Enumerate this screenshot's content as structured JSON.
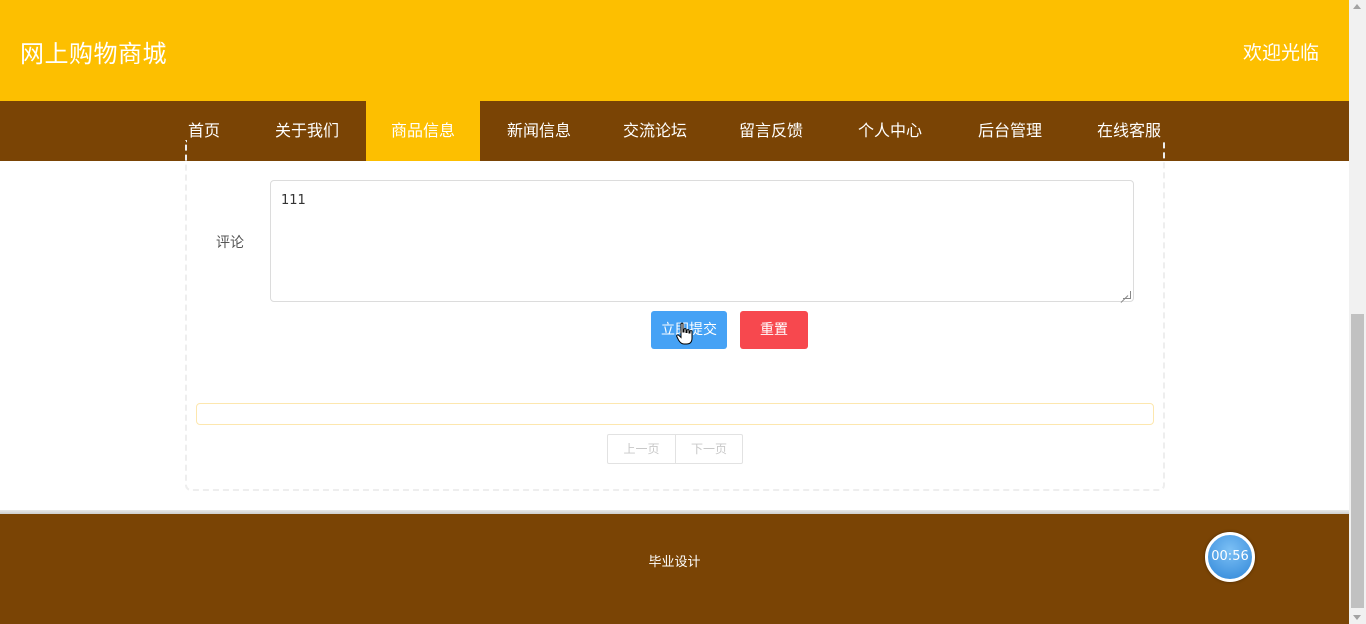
{
  "header": {
    "site_title": "网上购物商城",
    "welcome": "欢迎光临"
  },
  "nav": {
    "items": [
      {
        "label": "首页"
      },
      {
        "label": "关于我们"
      },
      {
        "label": "商品信息",
        "active": true
      },
      {
        "label": "新闻信息"
      },
      {
        "label": "交流论坛"
      },
      {
        "label": "留言反馈"
      },
      {
        "label": "个人中心"
      },
      {
        "label": "后台管理"
      },
      {
        "label": "在线客服"
      }
    ]
  },
  "comment_form": {
    "label": "评论",
    "value": "111",
    "submit_label": "立即提交",
    "reset_label": "重置"
  },
  "pagination": {
    "prev_label": "上一页",
    "next_label": "下一页"
  },
  "footer": {
    "text": "毕业设计"
  },
  "timer": {
    "value": "00:56"
  },
  "colors": {
    "header_bg": "#fdbf00",
    "nav_bg": "#7a4405",
    "submit_bg": "#46a2f5",
    "reset_bg": "#f7484e"
  }
}
